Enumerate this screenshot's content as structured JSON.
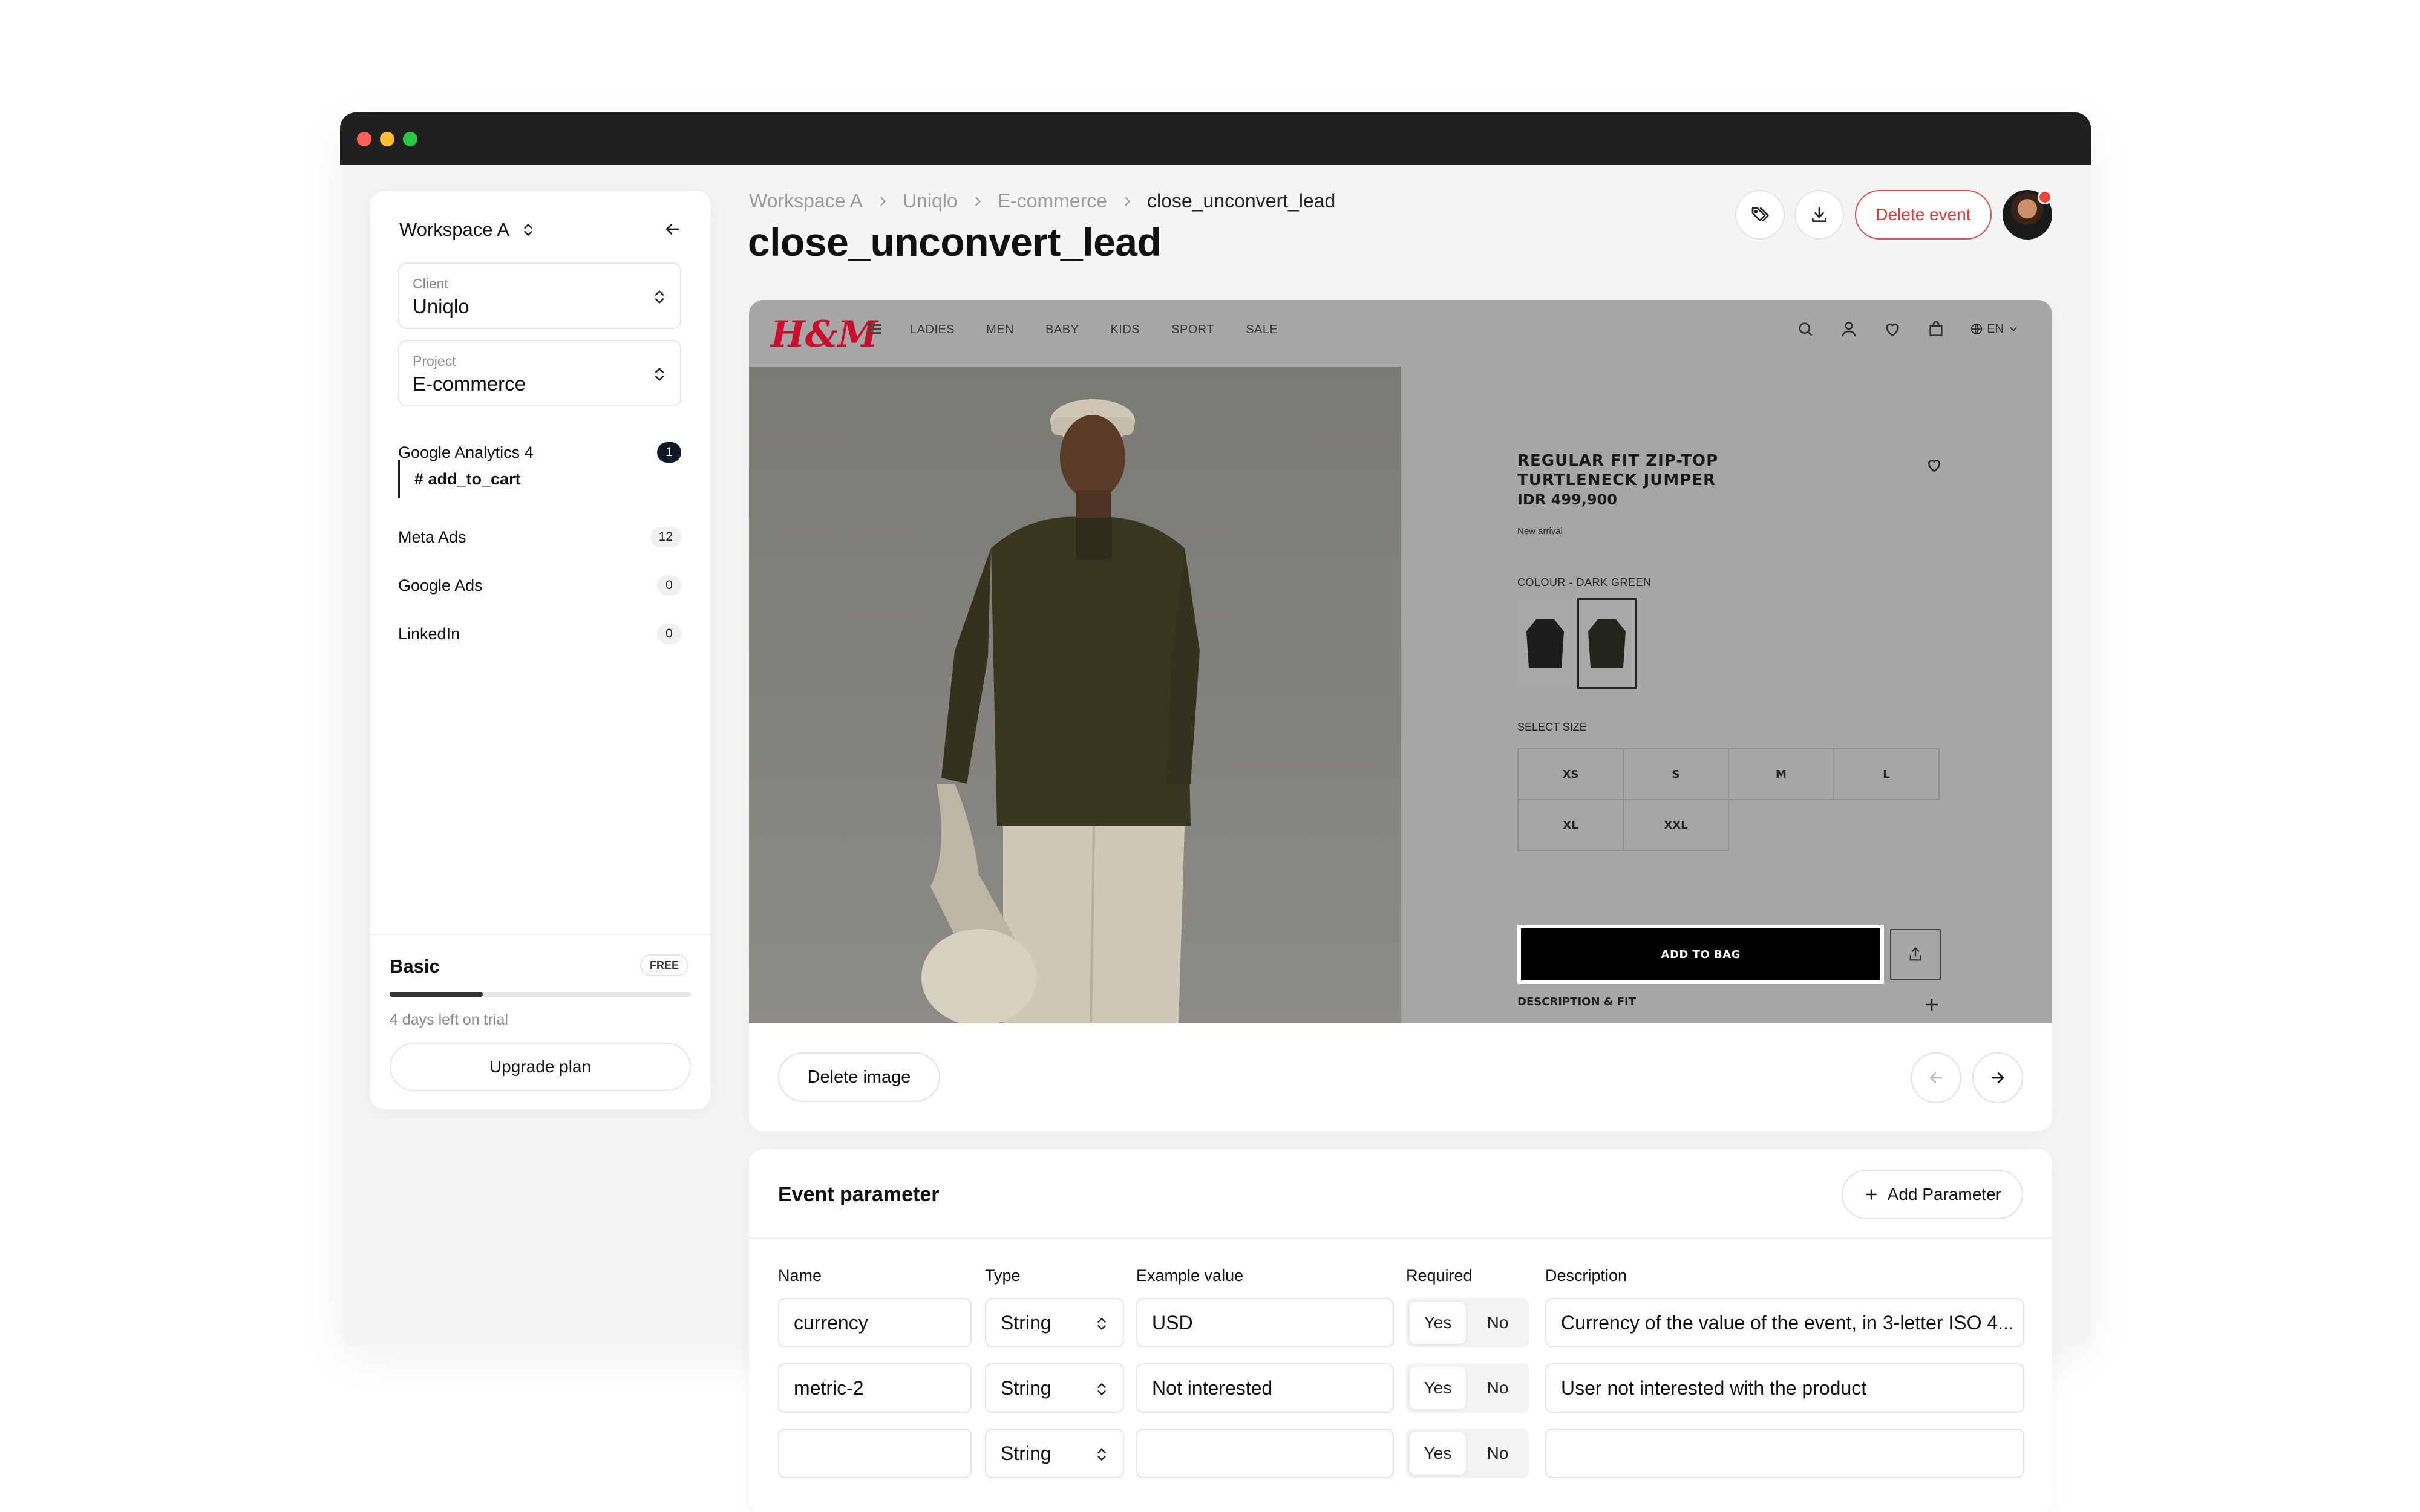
{
  "sidebar": {
    "workspace": "Workspace A",
    "client": {
      "label": "Client",
      "value": "Uniqlo"
    },
    "project": {
      "label": "Project",
      "value": "E-commerce"
    },
    "items": [
      {
        "label": "Google Analytics 4",
        "count": "1"
      },
      {
        "label": "Meta Ads",
        "count": "12"
      },
      {
        "label": "Google Ads",
        "count": "0"
      },
      {
        "label": "LinkedIn",
        "count": "0"
      }
    ],
    "sub_item": "# add_to_cart",
    "plan": {
      "name": "Basic",
      "badge": "FREE",
      "trial_text": "4 days left on trial",
      "upgrade_label": "Upgrade plan",
      "progress": 0.31
    }
  },
  "header": {
    "breadcrumbs": [
      "Workspace A",
      "Uniqlo",
      "E-commerce",
      "close_unconvert_lead"
    ],
    "title": "close_unconvert_lead",
    "delete_event_label": "Delete event"
  },
  "preview": {
    "logo": "H&M",
    "nav_links": [
      "LADIES",
      "MEN",
      "BABY",
      "KIDS",
      "SALE",
      "SPORT"
    ],
    "nav_display": [
      "LADIES",
      "MEN",
      "BABY",
      "KIDS",
      "SPORT",
      "SALE"
    ],
    "lang": "EN",
    "product_title_line1": "REGULAR FIT ZIP-TOP",
    "product_title_line2": "TURTLENECK JUMPER",
    "price": "IDR 499,900",
    "badge": "New arrival",
    "colour_label": "COLOUR - DARK GREEN",
    "size_label": "SELECT SIZE",
    "sizes": [
      "XS",
      "S",
      "M",
      "L",
      "XL",
      "XXL"
    ],
    "add_to_bag": "ADD TO BAG",
    "description_fit": "DESCRIPTION & FIT",
    "delete_image_label": "Delete image"
  },
  "params": {
    "title": "Event parameter",
    "add_label": "Add Parameter",
    "columns": {
      "name": "Name",
      "type": "Type",
      "example": "Example value",
      "required": "Required",
      "description": "Description"
    },
    "yes": "Yes",
    "no": "No",
    "rows": [
      {
        "name": "currency",
        "type": "String",
        "example": "USD",
        "required": "Yes",
        "description": "Currency of the value of the event, in 3-letter ISO 4..."
      },
      {
        "name": "metric-2",
        "type": "String",
        "example": "Not interested",
        "required": "Yes",
        "description": "User not interested with the product"
      },
      {
        "name": "",
        "type": "String",
        "example": "",
        "required": "Yes",
        "description": ""
      }
    ]
  },
  "colors": {
    "accent_red": "#d93a3a",
    "dark_badge": "#111827",
    "hm_red": "#c8102e"
  }
}
